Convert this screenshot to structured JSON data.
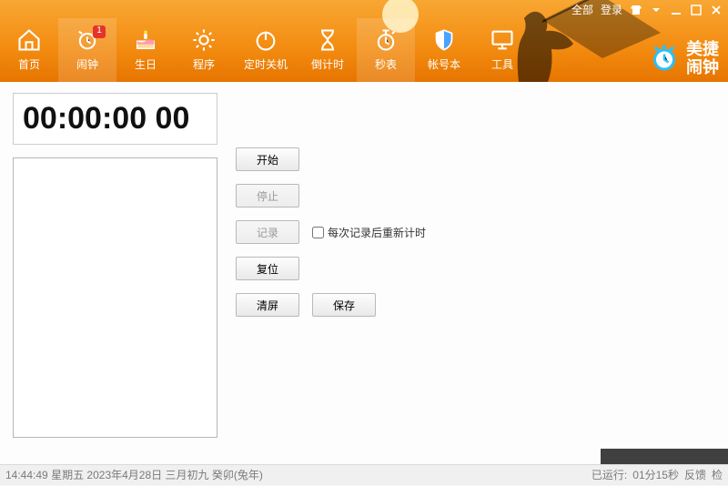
{
  "titlebar": {
    "all": "全部",
    "login": "登录"
  },
  "nav": {
    "items": [
      {
        "label": "首页"
      },
      {
        "label": "闹钟",
        "badge": "1"
      },
      {
        "label": "生日"
      },
      {
        "label": "程序"
      },
      {
        "label": "定时关机"
      },
      {
        "label": "倒计时"
      },
      {
        "label": "秒表"
      },
      {
        "label": "帐号本"
      },
      {
        "label": "工具"
      }
    ]
  },
  "brand": {
    "line1": "美捷",
    "line2": "闹钟"
  },
  "stopwatch": {
    "display": "00:00:00 00",
    "buttons": {
      "start": "开始",
      "stop": "停止",
      "record": "记录",
      "reset": "复位",
      "clear": "清屏",
      "save": "保存"
    },
    "reset_after_record_label": "每次记录后重新计时",
    "reset_after_record_checked": false
  },
  "status": {
    "time": "14:44:49",
    "weekday": "星期五",
    "date": "2023年4月28日",
    "lunar": "三月初九 癸卯(兔年)",
    "uptime_prefix": "已运行:",
    "uptime_value": "01分15秒",
    "feedback": "反馈",
    "extra": "检"
  }
}
